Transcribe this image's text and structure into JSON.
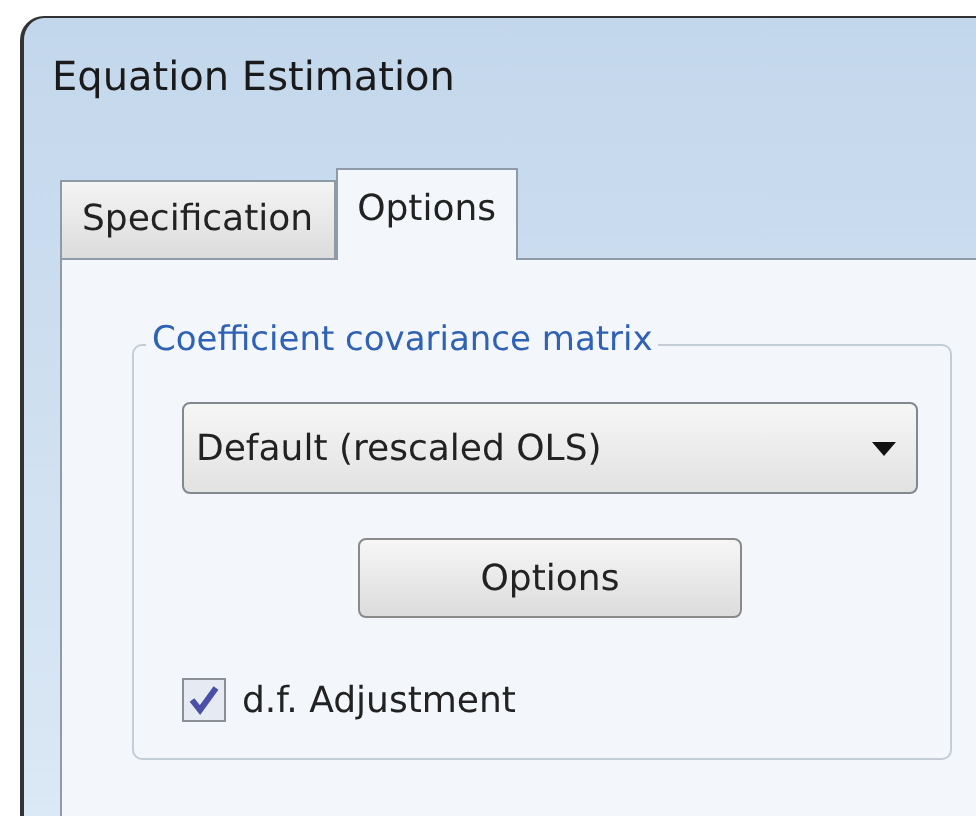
{
  "window": {
    "title": "Equation Estimation"
  },
  "tabs": [
    {
      "label": "Specification",
      "selected": false
    },
    {
      "label": "Options",
      "selected": true
    }
  ],
  "group": {
    "title": "Coefficient covariance matrix",
    "dropdown": {
      "value": "Default (rescaled OLS)"
    },
    "button": "Options",
    "checkbox": {
      "label": "d.f. Adjustment",
      "checked": true
    }
  }
}
